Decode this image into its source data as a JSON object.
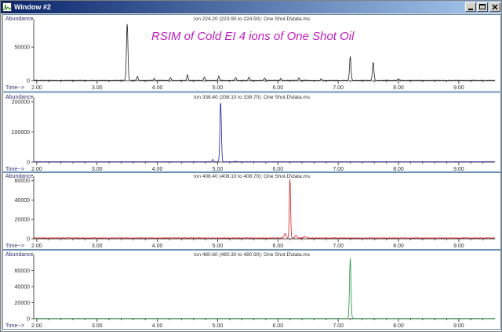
{
  "window": {
    "title": "Window #2",
    "accent_color": "#0a246a",
    "icons": [
      "app-icon",
      "minimize-icon",
      "maximize-icon",
      "close-icon"
    ]
  },
  "overlay_title": "RSIM of Cold EI 4 ions of One Shot Oil",
  "chart_data": [
    {
      "type": "line",
      "title": "Ion 224.20 (223.90 to 224.50): One Shot.D\\data.ms",
      "ylabel": "Abundance",
      "xlabel": "Time-->",
      "color": "#202020",
      "xlim": [
        1.95,
        9.6
      ],
      "ylim": [
        0,
        90000
      ],
      "yticks": [
        50000,
        0
      ],
      "xticks": [
        2.0,
        3.0,
        4.0,
        5.0,
        6.0,
        7.0,
        8.0,
        9.0
      ],
      "xtick_labels": [
        "2.00",
        "3.00",
        "4.00",
        "5.00",
        "6.00",
        "7.00",
        "8.00",
        "9.00"
      ],
      "baseline": 700,
      "peaks": [
        {
          "x": 3.5,
          "y": 85000,
          "w": 0.012
        },
        {
          "x": 3.67,
          "y": 6000,
          "w": 0.01
        },
        {
          "x": 3.95,
          "y": 2500,
          "w": 0.01
        },
        {
          "x": 4.22,
          "y": 4000,
          "w": 0.01
        },
        {
          "x": 4.5,
          "y": 8000,
          "w": 0.01
        },
        {
          "x": 4.78,
          "y": 5000,
          "w": 0.01
        },
        {
          "x": 5.02,
          "y": 6000,
          "w": 0.01
        },
        {
          "x": 5.3,
          "y": 4000,
          "w": 0.01
        },
        {
          "x": 5.52,
          "y": 4500,
          "w": 0.01
        },
        {
          "x": 5.78,
          "y": 3000,
          "w": 0.01
        },
        {
          "x": 6.05,
          "y": 2500,
          "w": 0.01
        },
        {
          "x": 6.35,
          "y": 3500,
          "w": 0.01
        },
        {
          "x": 6.72,
          "y": 2000,
          "w": 0.01
        },
        {
          "x": 7.2,
          "y": 36000,
          "w": 0.012
        },
        {
          "x": 7.58,
          "y": 27000,
          "w": 0.012
        },
        {
          "x": 8.0,
          "y": 2000,
          "w": 0.01
        }
      ]
    },
    {
      "type": "line",
      "title": "Ion 338.40 (338.10 to 338.70): One Shot.D\\data.ms",
      "ylabel": "Abundance",
      "xlabel": "Time-->",
      "color": "#2020a0",
      "xlim": [
        1.95,
        9.6
      ],
      "ylim": [
        0,
        210000
      ],
      "yticks": [
        200000,
        100000,
        0
      ],
      "xticks": [
        2.0,
        3.0,
        4.0,
        5.0,
        6.0,
        7.0,
        8.0,
        9.0
      ],
      "xtick_labels": [
        "2.00",
        "3.00",
        "4.00",
        "5.00",
        "6.00",
        "7.00",
        "8.00",
        "9.00"
      ],
      "baseline": 1000,
      "peaks": [
        {
          "x": 4.92,
          "y": 8000,
          "w": 0.01
        },
        {
          "x": 5.05,
          "y": 200000,
          "w": 0.012
        },
        {
          "x": 5.3,
          "y": 2000,
          "w": 0.01
        }
      ]
    },
    {
      "type": "line",
      "title": "Ion 408.40 (408.10 to 408.70): One Shot.D\\data.ms",
      "ylabel": "Abundance",
      "xlabel": "Time-->",
      "color": "#d02020",
      "xlim": [
        1.95,
        9.6
      ],
      "ylim": [
        0,
        63000
      ],
      "yticks": [
        60000,
        40000,
        20000,
        0
      ],
      "xticks": [
        2.0,
        3.0,
        4.0,
        5.0,
        6.0,
        7.0,
        8.0,
        9.0
      ],
      "xtick_labels": [
        "2.00",
        "3.00",
        "4.00",
        "5.00",
        "6.00",
        "7.00",
        "8.00",
        "9.00"
      ],
      "baseline": 800,
      "peaks": [
        {
          "x": 6.12,
          "y": 5000,
          "w": 0.015
        },
        {
          "x": 6.2,
          "y": 62000,
          "w": 0.01
        },
        {
          "x": 6.3,
          "y": 3000,
          "w": 0.015
        },
        {
          "x": 6.45,
          "y": 1500,
          "w": 0.02
        }
      ]
    },
    {
      "type": "line",
      "title": "Ion 480.60 (480.30 to 480.90): One Shot.D\\data.ms",
      "ylabel": "Abundance",
      "xlabel": "Time-->",
      "color": "#209040",
      "xlim": [
        1.95,
        9.6
      ],
      "ylim": [
        0,
        78000
      ],
      "yticks": [
        60000,
        40000,
        20000,
        0
      ],
      "xticks": [
        2.0,
        3.0,
        4.0,
        5.0,
        6.0,
        7.0,
        8.0,
        9.0
      ],
      "xtick_labels": [
        "2.00",
        "3.00",
        "4.00",
        "5.00",
        "6.00",
        "7.00",
        "8.00",
        "9.00"
      ],
      "baseline": 300,
      "peaks": [
        {
          "x": 7.2,
          "y": 75000,
          "w": 0.012
        }
      ]
    }
  ]
}
